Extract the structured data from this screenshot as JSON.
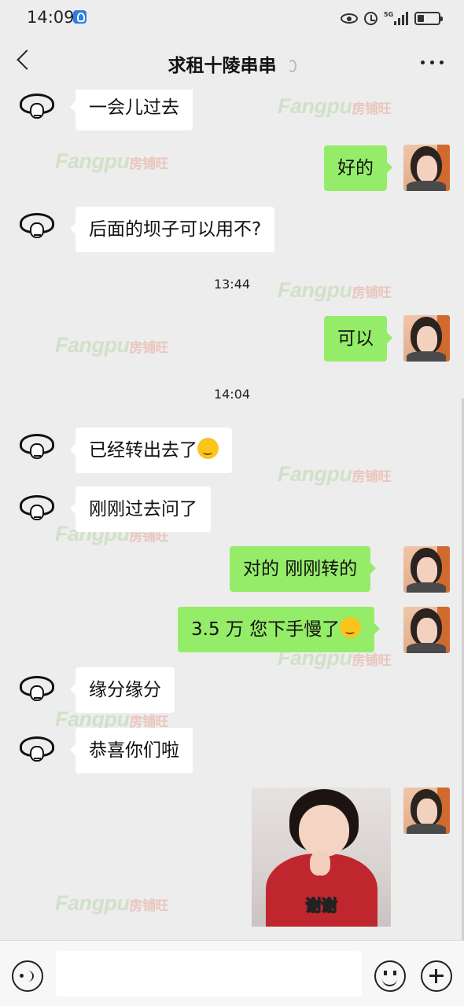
{
  "status_bar": {
    "time": "14:09",
    "network": "5G"
  },
  "header": {
    "title": "求租十陵串串"
  },
  "messages": [
    {
      "side": "left",
      "text": "一会儿过去"
    },
    {
      "side": "right",
      "text": "好的"
    },
    {
      "side": "left",
      "text": "后面的坝子可以用不?"
    },
    {
      "timestamp": "13:44"
    },
    {
      "side": "right",
      "text": "可以"
    },
    {
      "timestamp": "14:04"
    },
    {
      "side": "left",
      "text": "已经转出去了"
    },
    {
      "side": "left",
      "text": "刚刚过去问了"
    },
    {
      "side": "right",
      "text": "对的  刚刚转的"
    },
    {
      "side": "right",
      "text": "3.5 万  您下手慢了"
    },
    {
      "side": "left",
      "text": "缘分缘分"
    },
    {
      "side": "left",
      "text": "恭喜你们啦"
    },
    {
      "side": "right",
      "sticker_caption": "谢谢"
    }
  ],
  "watermark": {
    "brand": "Fangpu",
    "cn": "房铺旺"
  },
  "input_bar": {
    "placeholder": ""
  },
  "colors": {
    "background": "#ededed",
    "bubble_right": "#95ec69",
    "bubble_left": "#ffffff",
    "input_bar": "#f7f7f7"
  }
}
